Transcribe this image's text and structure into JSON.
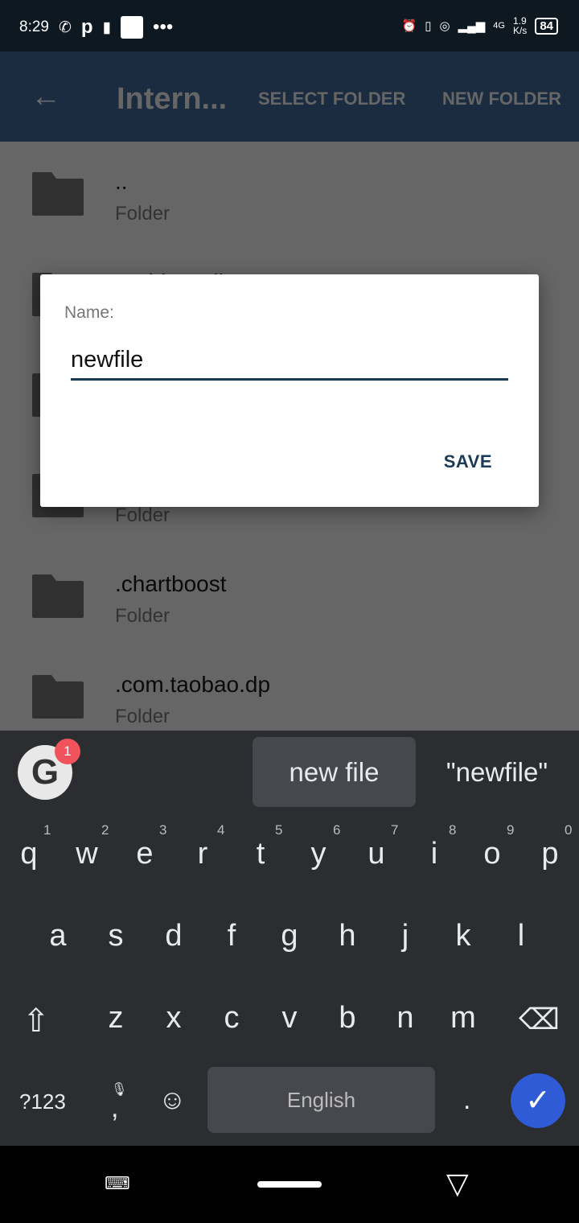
{
  "status": {
    "time": "8:29",
    "network_speed": "1.9",
    "speed_unit": "K/s",
    "network_type": "4G",
    "battery": "84"
  },
  "appbar": {
    "title": "Intern...",
    "select_folder": "SELECT FOLDER",
    "new_folder": "NEW FOLDER"
  },
  "list": [
    {
      "name": "..",
      "type": "Folder"
    },
    {
      "name": ".1VideoEditor",
      "type": ""
    },
    {
      "name": "",
      "type": ""
    },
    {
      "name": "",
      "type": "Folder"
    },
    {
      "name": ".chartboost",
      "type": "Folder"
    },
    {
      "name": ".com.taobao.dp",
      "type": "Folder"
    }
  ],
  "dialog": {
    "label": "Name:",
    "value": "newfile",
    "save": "SAVE"
  },
  "keyboard": {
    "badge": "1",
    "suggestions": [
      "new file",
      "\"newfile\""
    ],
    "row1": [
      "q",
      "w",
      "e",
      "r",
      "t",
      "y",
      "u",
      "i",
      "o",
      "p"
    ],
    "hints": [
      "1",
      "2",
      "3",
      "4",
      "5",
      "6",
      "7",
      "8",
      "9",
      "0"
    ],
    "row2": [
      "a",
      "s",
      "d",
      "f",
      "g",
      "h",
      "j",
      "k",
      "l"
    ],
    "row3": [
      "z",
      "x",
      "c",
      "v",
      "b",
      "n",
      "m"
    ],
    "symbols": "?123",
    "comma": ",",
    "space": "English",
    "period": "."
  },
  "colors": {
    "appbar": "#1b2c40",
    "accent": "#1b3a55",
    "enter": "#2f5bd6"
  }
}
